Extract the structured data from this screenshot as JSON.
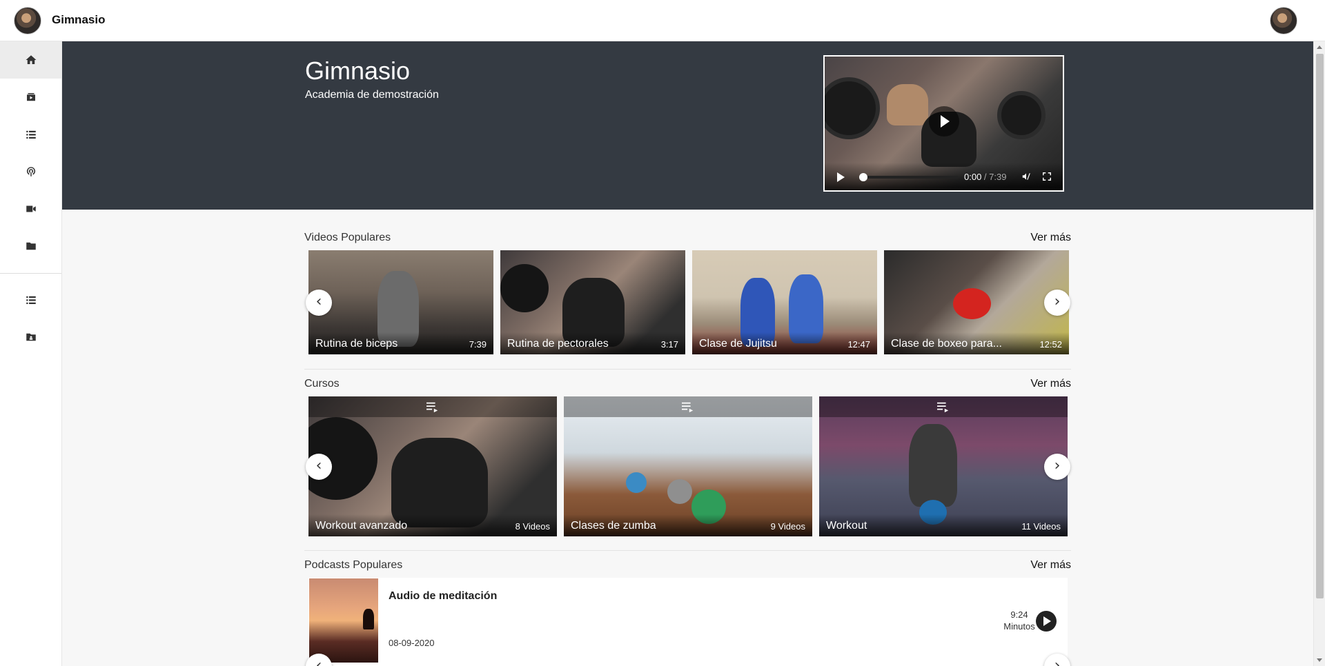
{
  "app": {
    "title": "Gimnasio"
  },
  "hero": {
    "title": "Gimnasio",
    "subtitle": "Academia de demostración",
    "player": {
      "current_time": "0:00",
      "separator": " / ",
      "duration": "7:39"
    }
  },
  "sidebar": {
    "items": [
      {
        "name": "home-icon"
      },
      {
        "name": "video-library-icon"
      },
      {
        "name": "list-icon"
      },
      {
        "name": "podcast-icon"
      },
      {
        "name": "videocam-icon"
      },
      {
        "name": "folder-icon"
      },
      {
        "name": "list-icon"
      },
      {
        "name": "folder-user-icon"
      }
    ]
  },
  "sections": {
    "videos": {
      "title": "Videos Populares",
      "more": "Ver más",
      "items": [
        {
          "title": "Rutina de biceps",
          "duration": "7:39"
        },
        {
          "title": "Rutina de pectorales",
          "duration": "3:17"
        },
        {
          "title": "Clase de Jujitsu",
          "duration": "12:47"
        },
        {
          "title": "Clase de boxeo para...",
          "duration": "12:52"
        }
      ]
    },
    "courses": {
      "title": "Cursos",
      "more": "Ver más",
      "items": [
        {
          "title": "Workout avanzado",
          "count": "8 Videos"
        },
        {
          "title": "Clases de zumba",
          "count": "9 Videos"
        },
        {
          "title": "Workout",
          "count": "11 Videos"
        }
      ]
    },
    "podcasts": {
      "title": "Podcasts Populares",
      "more": "Ver más",
      "items": [
        {
          "title": "Audio de meditación",
          "date": "08-09-2020",
          "duration": "9:24",
          "unit": "Minutos"
        }
      ]
    }
  },
  "nav": {
    "prev": "‹",
    "next": "›"
  }
}
